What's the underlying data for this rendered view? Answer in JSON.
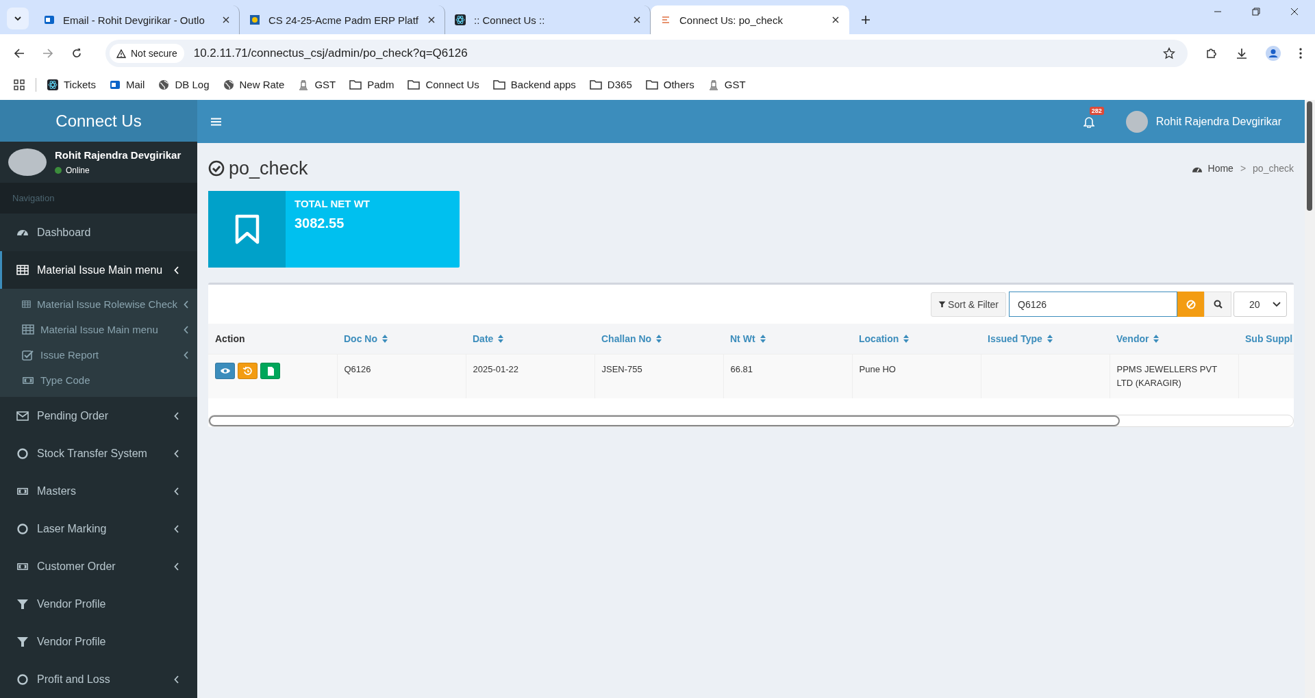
{
  "browser": {
    "tabs": [
      {
        "title": "Email - Rohit Devgirikar - Outlo",
        "selected": false
      },
      {
        "title": "CS 24-25-Acme Padm ERP Platf",
        "selected": false
      },
      {
        "title": ":: Connect Us ::",
        "selected": false
      },
      {
        "title": "Connect Us: po_check",
        "selected": true
      }
    ],
    "address": {
      "security": "Not secure",
      "url": "10.2.11.71/connectus_csj/admin/po_check?q=Q6126"
    },
    "bookmarks": [
      {
        "label": "Tickets",
        "kind": "site"
      },
      {
        "label": "Mail",
        "kind": "site"
      },
      {
        "label": "DB Log",
        "kind": "site"
      },
      {
        "label": "New Rate",
        "kind": "site"
      },
      {
        "label": "GST",
        "kind": "site"
      },
      {
        "label": "Padm",
        "kind": "folder"
      },
      {
        "label": "Connect Us",
        "kind": "folder"
      },
      {
        "label": "Backend apps",
        "kind": "folder"
      },
      {
        "label": "D365",
        "kind": "folder"
      },
      {
        "label": "Others",
        "kind": "folder"
      },
      {
        "label": "GST",
        "kind": "site"
      }
    ]
  },
  "sidebar": {
    "brand": "Connect Us",
    "user": {
      "name": "Rohit Rajendra Devgirikar",
      "status": "Online"
    },
    "nav_header": "Navigation",
    "items": [
      {
        "label": "Dashboard",
        "selected": false,
        "has_submenu": false
      },
      {
        "label": "Material Issue Main menu",
        "selected": true,
        "has_submenu": true,
        "expanded": true,
        "children": [
          {
            "label": "Material Issue Rolewise Check",
            "has_submenu": true
          },
          {
            "label": "Material Issue Main menu",
            "has_submenu": true
          },
          {
            "label": "Issue Report",
            "has_submenu": true
          },
          {
            "label": "Type Code",
            "has_submenu": false
          }
        ]
      },
      {
        "label": "Pending Order",
        "selected": false,
        "has_submenu": true
      },
      {
        "label": "Stock Transfer System",
        "selected": false,
        "has_submenu": true
      },
      {
        "label": "Masters",
        "selected": false,
        "has_submenu": true
      },
      {
        "label": "Laser Marking",
        "selected": false,
        "has_submenu": true
      },
      {
        "label": "Customer Order",
        "selected": false,
        "has_submenu": true
      },
      {
        "label": "Vendor Profile",
        "selected": false,
        "has_submenu": false
      },
      {
        "label": "Vendor Profile",
        "selected": false,
        "has_submenu": false
      },
      {
        "label": "Profit and Loss",
        "selected": false,
        "has_submenu": true
      }
    ]
  },
  "topbar": {
    "notifications": "282",
    "user_name": "Rohit Rajendra Devgirikar"
  },
  "page": {
    "title": "po_check",
    "breadcrumb": [
      "Home",
      "po_check"
    ],
    "breadcrumb_separator": ">"
  },
  "info_box": {
    "label": "TOTAL NET WT",
    "value": "3082.55"
  },
  "toolbar": {
    "filter_button": "Sort & Filter",
    "search": "Q6126",
    "page_size": "20"
  },
  "table": {
    "columns": [
      {
        "label": "Action",
        "sortable": false
      },
      {
        "label": "Doc No",
        "sortable": true
      },
      {
        "label": "Date",
        "sortable": true
      },
      {
        "label": "Challan No",
        "sortable": true
      },
      {
        "label": "Nt Wt",
        "sortable": true
      },
      {
        "label": "Location",
        "sortable": true
      },
      {
        "label": "Issued Type",
        "sortable": true
      },
      {
        "label": "Vendor",
        "sortable": true
      },
      {
        "label": "Sub Suppl",
        "sortable": false
      }
    ],
    "rows": [
      {
        "cells": [
          "",
          "Q6126",
          "2025-01-22",
          "JSEN-755",
          "66.81",
          "Pune HO",
          "",
          "PPMS JEWELLERS PVT LTD (KARAGIR)",
          ""
        ]
      }
    ]
  }
}
